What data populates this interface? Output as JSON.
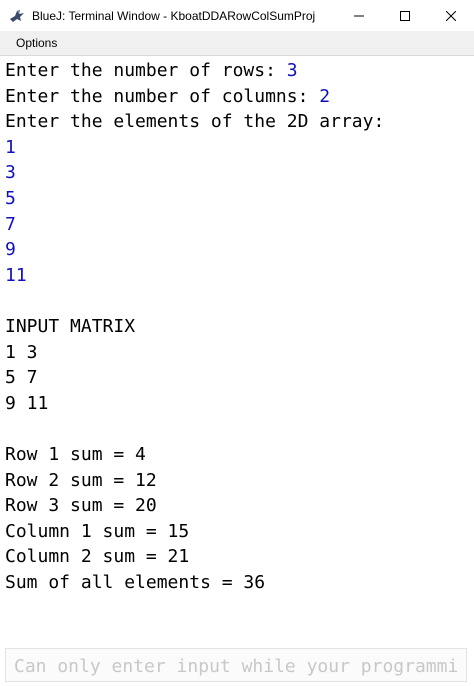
{
  "window": {
    "title": "BlueJ: Terminal Window - KboatDDARowColSumProj",
    "icons": {
      "app": "bluej-bird-icon",
      "minimize": "minimize-icon",
      "maximize": "maximize-icon",
      "close": "close-icon"
    }
  },
  "menu": {
    "options_label": "Options"
  },
  "colors": {
    "user_input": "#1010c0",
    "placeholder": "#c8c8c8"
  },
  "terminal": {
    "prompt_rows": "Enter the number of rows: ",
    "value_rows": "3",
    "prompt_cols": "Enter the number of columns: ",
    "value_cols": "2",
    "prompt_elements": "Enter the elements of the 2D array:",
    "elements": [
      "1",
      "3",
      "5",
      "7",
      "9",
      "11"
    ],
    "matrix_header": "INPUT MATRIX",
    "matrix_rows": [
      "1 3",
      "5 7",
      "9 11"
    ],
    "results": [
      "Row 1 sum = 4",
      "Row 2 sum = 12",
      "Row 3 sum = 20",
      "Column 1 sum = 15",
      "Column 2 sum = 21",
      "Sum of all elements = 36"
    ]
  },
  "input": {
    "placeholder": "Can only enter input while your programmi"
  }
}
